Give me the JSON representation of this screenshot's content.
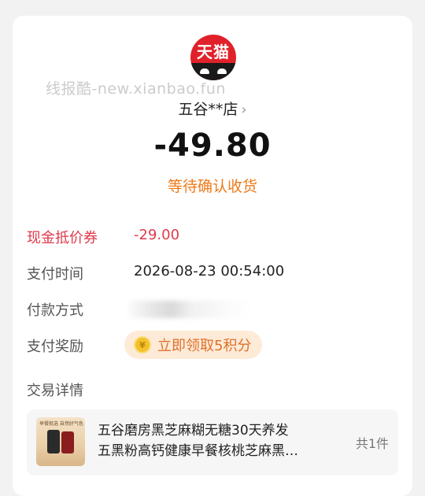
{
  "colors": {
    "brand_red": "#e0212a",
    "status_orange": "#f07a1a",
    "discount_red": "#e03a4b",
    "reward_bg": "#fdebd8"
  },
  "logo": {
    "text": "天猫",
    "icon": "tmall-cat-logo"
  },
  "watermark": "线报酷-new.xianbao.fun",
  "store": {
    "name": "五谷**店",
    "chevron": "›"
  },
  "amount": "-49.80",
  "status": "等待确认收货",
  "details": {
    "coupon": {
      "label": "现金抵价券",
      "value": "-29.00"
    },
    "pay_time": {
      "label": "支付时间",
      "value": "2026-08-23 00:54:00"
    },
    "pay_method": {
      "label": "付款方式"
    },
    "reward": {
      "label": "支付奖励",
      "action": "立即领取5积分",
      "coin_glyph": "¥"
    },
    "trade_detail": {
      "label": "交易详情"
    }
  },
  "product": {
    "title_line1": "五谷磨房黑芝麻糊无糖30天养发",
    "title_line2": "五黑粉高钙健康早餐核桃芝麻黑…",
    "quantity": "共1件",
    "thumb_caption": "早餐就选 自然好气色"
  }
}
